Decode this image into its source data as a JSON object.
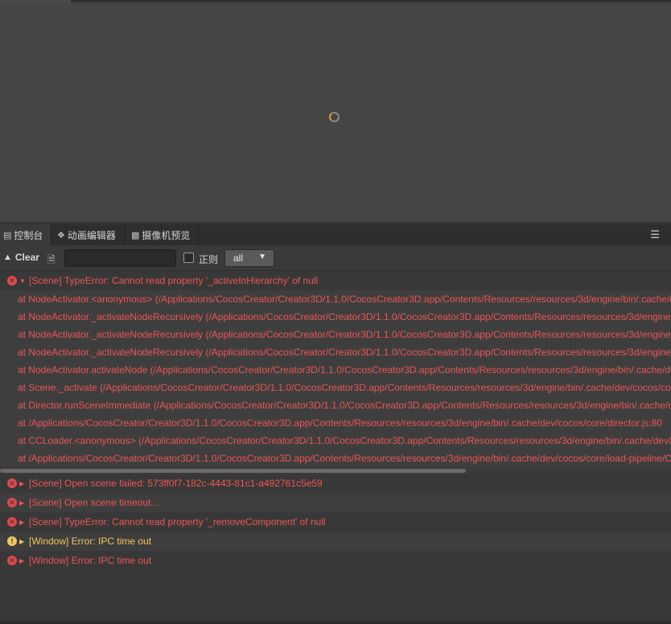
{
  "tabs": [
    {
      "label": "控制台",
      "icon": "terminal-icon"
    },
    {
      "label": "动画编辑器",
      "icon": "animation-icon"
    },
    {
      "label": "摄像机预览",
      "icon": "camera-icon"
    }
  ],
  "toolbar": {
    "clear_label": "Clear",
    "search_value": "",
    "search_placeholder": "",
    "regex_label": "正则",
    "filter_value": "all"
  },
  "log": {
    "first_entry": {
      "level": "error",
      "expanded": true,
      "message": "[Scene] TypeError: Cannot read property '_activeInHierarchy' of null",
      "stack": [
        "at NodeActivator.<anonymous> (/Applications/CocosCreator/Creator3D/1.1.0/CocosCreator3D.app/Contents/Resources/resources/3d/engine/bin/.cache/dev/cocos/core/scene-graph/node-activator.js",
        "at NodeActivator._activateNodeRecursively (/Applications/CocosCreator/Creator3D/1.1.0/CocosCreator3D.app/Contents/Resources/resources/3d/engine/bin/.cache/dev/cocos/core/scene-graph",
        "at NodeActivator._activateNodeRecursively (/Applications/CocosCreator/Creator3D/1.1.0/CocosCreator3D.app/Contents/Resources/resources/3d/engine/bin/.cache/dev/cocos/core/scene-graph",
        "at NodeActivator._activateNodeRecursively (/Applications/CocosCreator/Creator3D/1.1.0/CocosCreator3D.app/Contents/Resources/resources/3d/engine/bin/.cache/dev/cocos/core/scene-graph",
        "at NodeActivator.activateNode (/Applications/CocosCreator/Creator3D/1.1.0/CocosCreator3D.app/Contents/Resources/resources/3d/engine/bin/.cache/dev/cocos/core/scene-graph/node-activator",
        "at Scene._activate (/Applications/CocosCreator/Creator3D/1.1.0/CocosCreator3D.app/Contents/Resources/resources/3d/engine/bin/.cache/dev/cocos/core/scene-graph/scene.js",
        "at Director.runSceneImmediate (/Applications/CocosCreator/Creator3D/1.1.0/CocosCreator3D.app/Contents/Resources/resources/3d/engine/bin/.cache/dev/cocos/core/director.js",
        "at /Applications/CocosCreator/Creator3D/1.1.0/CocosCreator3D.app/Contents/Resources/resources/3d/engine/bin/.cache/dev/cocos/core/director.js:80",
        "at CCLoader.<anonymous> (/Applications/CocosCreator/Creator3D/1.1.0/CocosCreator3D.app/Contents/Resources/resources/3d/engine/bin/.cache/dev/cocos/core/load-pipeline",
        "at /Applications/CocosCreator/Creator3D/1.1.0/CocosCreator3D.app/Contents/Resources/resources/3d/engine/bin/.cache/dev/cocos/core/load-pipeline/CCLoader.js"
      ]
    },
    "entries": [
      {
        "level": "error",
        "message": "[Scene] Open scene failed: 573ff0f7-182c-4443-81c1-a492761c5e59"
      },
      {
        "level": "error",
        "message": "[Scene] Open scene timeout..."
      },
      {
        "level": "error",
        "message": "[Scene] TypeError: Cannot read property '_removeComponent' of null"
      },
      {
        "level": "warning",
        "message": "[Window] Error: IPC time out"
      },
      {
        "level": "error",
        "message": "[Window] Error: IPC time out"
      }
    ]
  },
  "colors": {
    "error": "#ee5555",
    "warning": "#f0c75e",
    "accent_spinner": "#e2a12b"
  }
}
